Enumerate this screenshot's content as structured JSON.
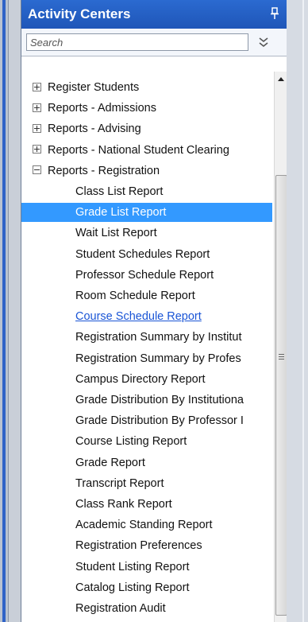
{
  "panel": {
    "title": "Activity Centers",
    "search": {
      "placeholder": "Search",
      "value": ""
    }
  },
  "tree": [
    {
      "label": "Register Students",
      "type": "parent",
      "expanded": false
    },
    {
      "label": "Reports - Admissions",
      "type": "parent",
      "expanded": false
    },
    {
      "label": "Reports - Advising",
      "type": "parent",
      "expanded": false
    },
    {
      "label": "Reports - National Student Clearing",
      "type": "parent",
      "expanded": false
    },
    {
      "label": "Reports - Registration",
      "type": "parent",
      "expanded": true
    },
    {
      "label": "Class List Report",
      "type": "child"
    },
    {
      "label": "Grade List Report",
      "type": "child",
      "selected": true
    },
    {
      "label": "Wait List Report",
      "type": "child"
    },
    {
      "label": "Student Schedules Report",
      "type": "child"
    },
    {
      "label": "Professor Schedule Report",
      "type": "child"
    },
    {
      "label": "Room Schedule Report",
      "type": "child"
    },
    {
      "label": "Course Schedule Report",
      "type": "child",
      "hover": true
    },
    {
      "label": "Registration Summary by Institut",
      "type": "child"
    },
    {
      "label": "Registration Summary by Profes",
      "type": "child"
    },
    {
      "label": "Campus Directory Report",
      "type": "child"
    },
    {
      "label": "Grade Distribution By Institutiona",
      "type": "child"
    },
    {
      "label": "Grade Distribution By Professor I",
      "type": "child"
    },
    {
      "label": "Course Listing Report",
      "type": "child"
    },
    {
      "label": "Grade Report",
      "type": "child"
    },
    {
      "label": "Transcript Report",
      "type": "child"
    },
    {
      "label": "Class Rank Report",
      "type": "child"
    },
    {
      "label": "Academic Standing Report",
      "type": "child"
    },
    {
      "label": "Registration Preferences",
      "type": "child"
    },
    {
      "label": "Student Listing Report",
      "type": "child"
    },
    {
      "label": "Catalog Listing Report",
      "type": "child"
    },
    {
      "label": "Registration Audit",
      "type": "child"
    }
  ],
  "icons": {
    "pin": "pin-icon",
    "expand": "double-chevron-down-icon",
    "scroll_up": "arrow-up-icon"
  },
  "colors": {
    "titlebar": "#2464c8",
    "selected": "#3399ff",
    "link": "#1a55d6"
  }
}
